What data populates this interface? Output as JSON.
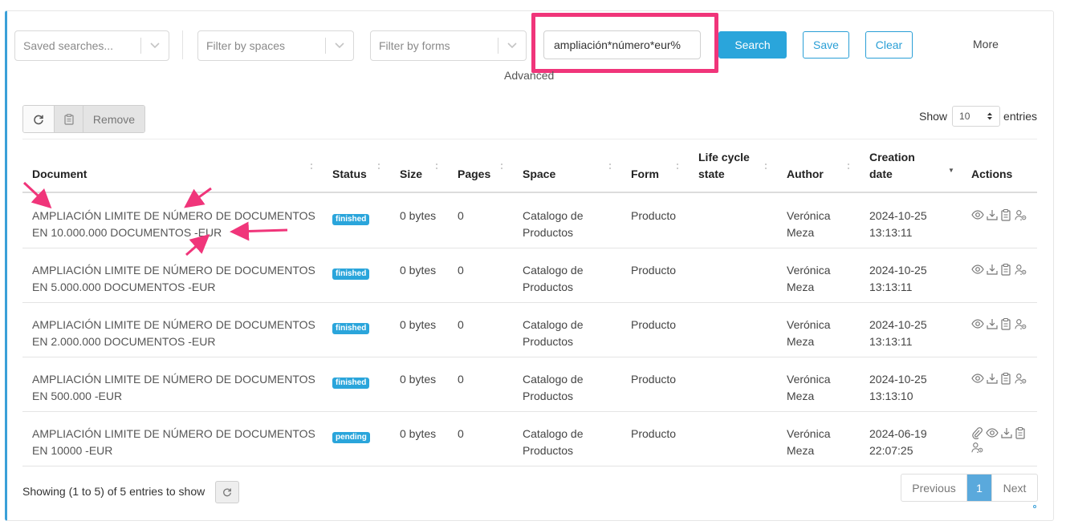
{
  "filters": {
    "saved_searches_placeholder": "Saved searches...",
    "spaces_placeholder": "Filter by spaces",
    "forms_placeholder": "Filter by forms",
    "search_value": "ampliación*número*eur%",
    "search_button": "Search",
    "save_button": "Save",
    "clear_button": "Clear",
    "more_link": "More",
    "advanced_label": "Advanced"
  },
  "toolbar": {
    "remove_label": "Remove",
    "show_label": "Show",
    "entries_value": "10",
    "entries_label": "entries"
  },
  "table": {
    "headers": {
      "document": "Document",
      "status": "Status",
      "size": "Size",
      "pages": "Pages",
      "space": "Space",
      "form": "Form",
      "lifecycle": "Life cycle state",
      "author": "Author",
      "creation_date": "Creation date",
      "actions": "Actions"
    },
    "rows": [
      {
        "document": "AMPLIACIÓN LIMITE DE NÚMERO DE DOCUMENTOS EN 10.000.000 DOCUMENTOS -EUR",
        "status": "finished",
        "size": "0 bytes",
        "pages": "0",
        "space": "Catalogo de Productos",
        "form": "Producto",
        "lifecycle": "",
        "author": "Verónica Meza",
        "date": "2024-10-25 13:13:11"
      },
      {
        "document": "AMPLIACIÓN LIMITE DE NÚMERO DE DOCUMENTOS EN 5.000.000 DOCUMENTOS -EUR",
        "status": "finished",
        "size": "0 bytes",
        "pages": "0",
        "space": "Catalogo de Productos",
        "form": "Producto",
        "lifecycle": "",
        "author": "Verónica Meza",
        "date": "2024-10-25 13:13:11"
      },
      {
        "document": "AMPLIACIÓN LIMITE DE NÚMERO DE DOCUMENTOS EN 2.000.000 DOCUMENTOS -EUR",
        "status": "finished",
        "size": "0 bytes",
        "pages": "0",
        "space": "Catalogo de Productos",
        "form": "Producto",
        "lifecycle": "",
        "author": "Verónica Meza",
        "date": "2024-10-25 13:13:11"
      },
      {
        "document": "AMPLIACIÓN LIMITE DE NÚMERO DE DOCUMENTOS EN 500.000 -EUR",
        "status": "finished",
        "size": "0 bytes",
        "pages": "0",
        "space": "Catalogo de Productos",
        "form": "Producto",
        "lifecycle": "",
        "author": "Verónica Meza",
        "date": "2024-10-25 13:13:10"
      },
      {
        "document": "AMPLIACIÓN LIMITE DE NÚMERO DE DOCUMENTOS EN 10000 -EUR",
        "status": "pending",
        "size": "0 bytes",
        "pages": "0",
        "space": "Catalogo de Productos",
        "form": "Producto",
        "lifecycle": "",
        "author": "Verónica Meza",
        "date": "2024-06-19 22:07:25"
      }
    ]
  },
  "footer": {
    "info": "Showing (1 to 5) of 5 entries to show",
    "previous": "Previous",
    "page": "1",
    "next": "Next"
  },
  "colors": {
    "accent": "#2aa5db",
    "annotation": "#f0357a"
  }
}
